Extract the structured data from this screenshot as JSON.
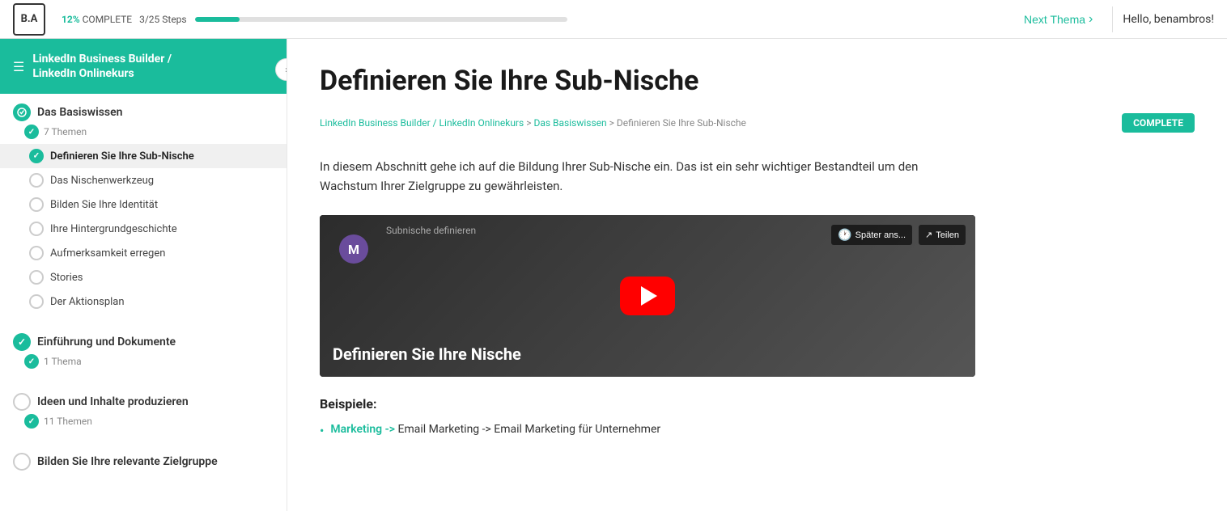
{
  "logo": {
    "text": "B.A"
  },
  "topbar": {
    "progress_pct": "12%",
    "progress_label": "COMPLETE",
    "steps_label": "3/25 Steps",
    "progress_fill_width": "12%",
    "next_thema": "Next Thema",
    "user_greeting": "Hello, benambros!"
  },
  "sidebar": {
    "header_title": "LinkedIn Business Builder /\nLinkedIn Onlinekurs",
    "sections": [
      {
        "id": "basiswissen",
        "title": "Das Basiswissen",
        "count_label": "7 Themen",
        "is_active": true,
        "completed": false,
        "lessons": [
          {
            "label": "Definieren Sie Ihre Sub-Nische",
            "completed": true,
            "active": true
          },
          {
            "label": "Das Nischenwerkzeug",
            "completed": false,
            "active": false
          },
          {
            "label": "Bilden Sie Ihre Identität",
            "completed": false,
            "active": false
          },
          {
            "label": "Ihre Hintergrundgeschichte",
            "completed": false,
            "active": false
          },
          {
            "label": "Aufmerksamkeit erregen",
            "completed": false,
            "active": false
          },
          {
            "label": "Stories",
            "completed": false,
            "active": false
          },
          {
            "label": "Der Aktionsplan",
            "completed": false,
            "active": false
          }
        ]
      },
      {
        "id": "einfuhrung",
        "title": "Einführung und Dokumente",
        "count_label": "1 Thema",
        "completed": true,
        "lessons": []
      },
      {
        "id": "ideen",
        "title": "Ideen und Inhalte produzieren",
        "count_label": "11 Themen",
        "completed": false,
        "lessons": []
      },
      {
        "id": "bilden",
        "title": "Bilden Sie Ihre relevante Zielgruppe",
        "count_label": "",
        "completed": false,
        "lessons": []
      }
    ]
  },
  "content": {
    "page_title": "Definieren Sie Ihre Sub-Nische",
    "breadcrumb": {
      "parts": [
        "LinkedIn Business Builder / LinkedIn Onlinekurs",
        "Das Basiswissen",
        "Definieren Sie Ihre Sub-Nische"
      ],
      "separator": ">"
    },
    "complete_badge": "COMPLETE",
    "intro_text": "In diesem Abschnitt gehe ich auf die Bildung Ihrer Sub-Nische ein. Das ist ein sehr wichtiger Bestandteil um den Wachstum Ihrer Zielgruppe zu gewährleisten.",
    "video": {
      "channel_icon": "M",
      "channel_name": "Subnische definieren",
      "title": "Definieren Sie Ihre Nische",
      "later_btn": "Später ans...",
      "share_btn": "Teilen"
    },
    "examples_label": "Beispiele:",
    "examples": [
      {
        "text_teal": "Marketing ->",
        "text_dark": "Email Marketing ->",
        "text_rest": "Email Marketing für Unternehmer"
      }
    ]
  }
}
